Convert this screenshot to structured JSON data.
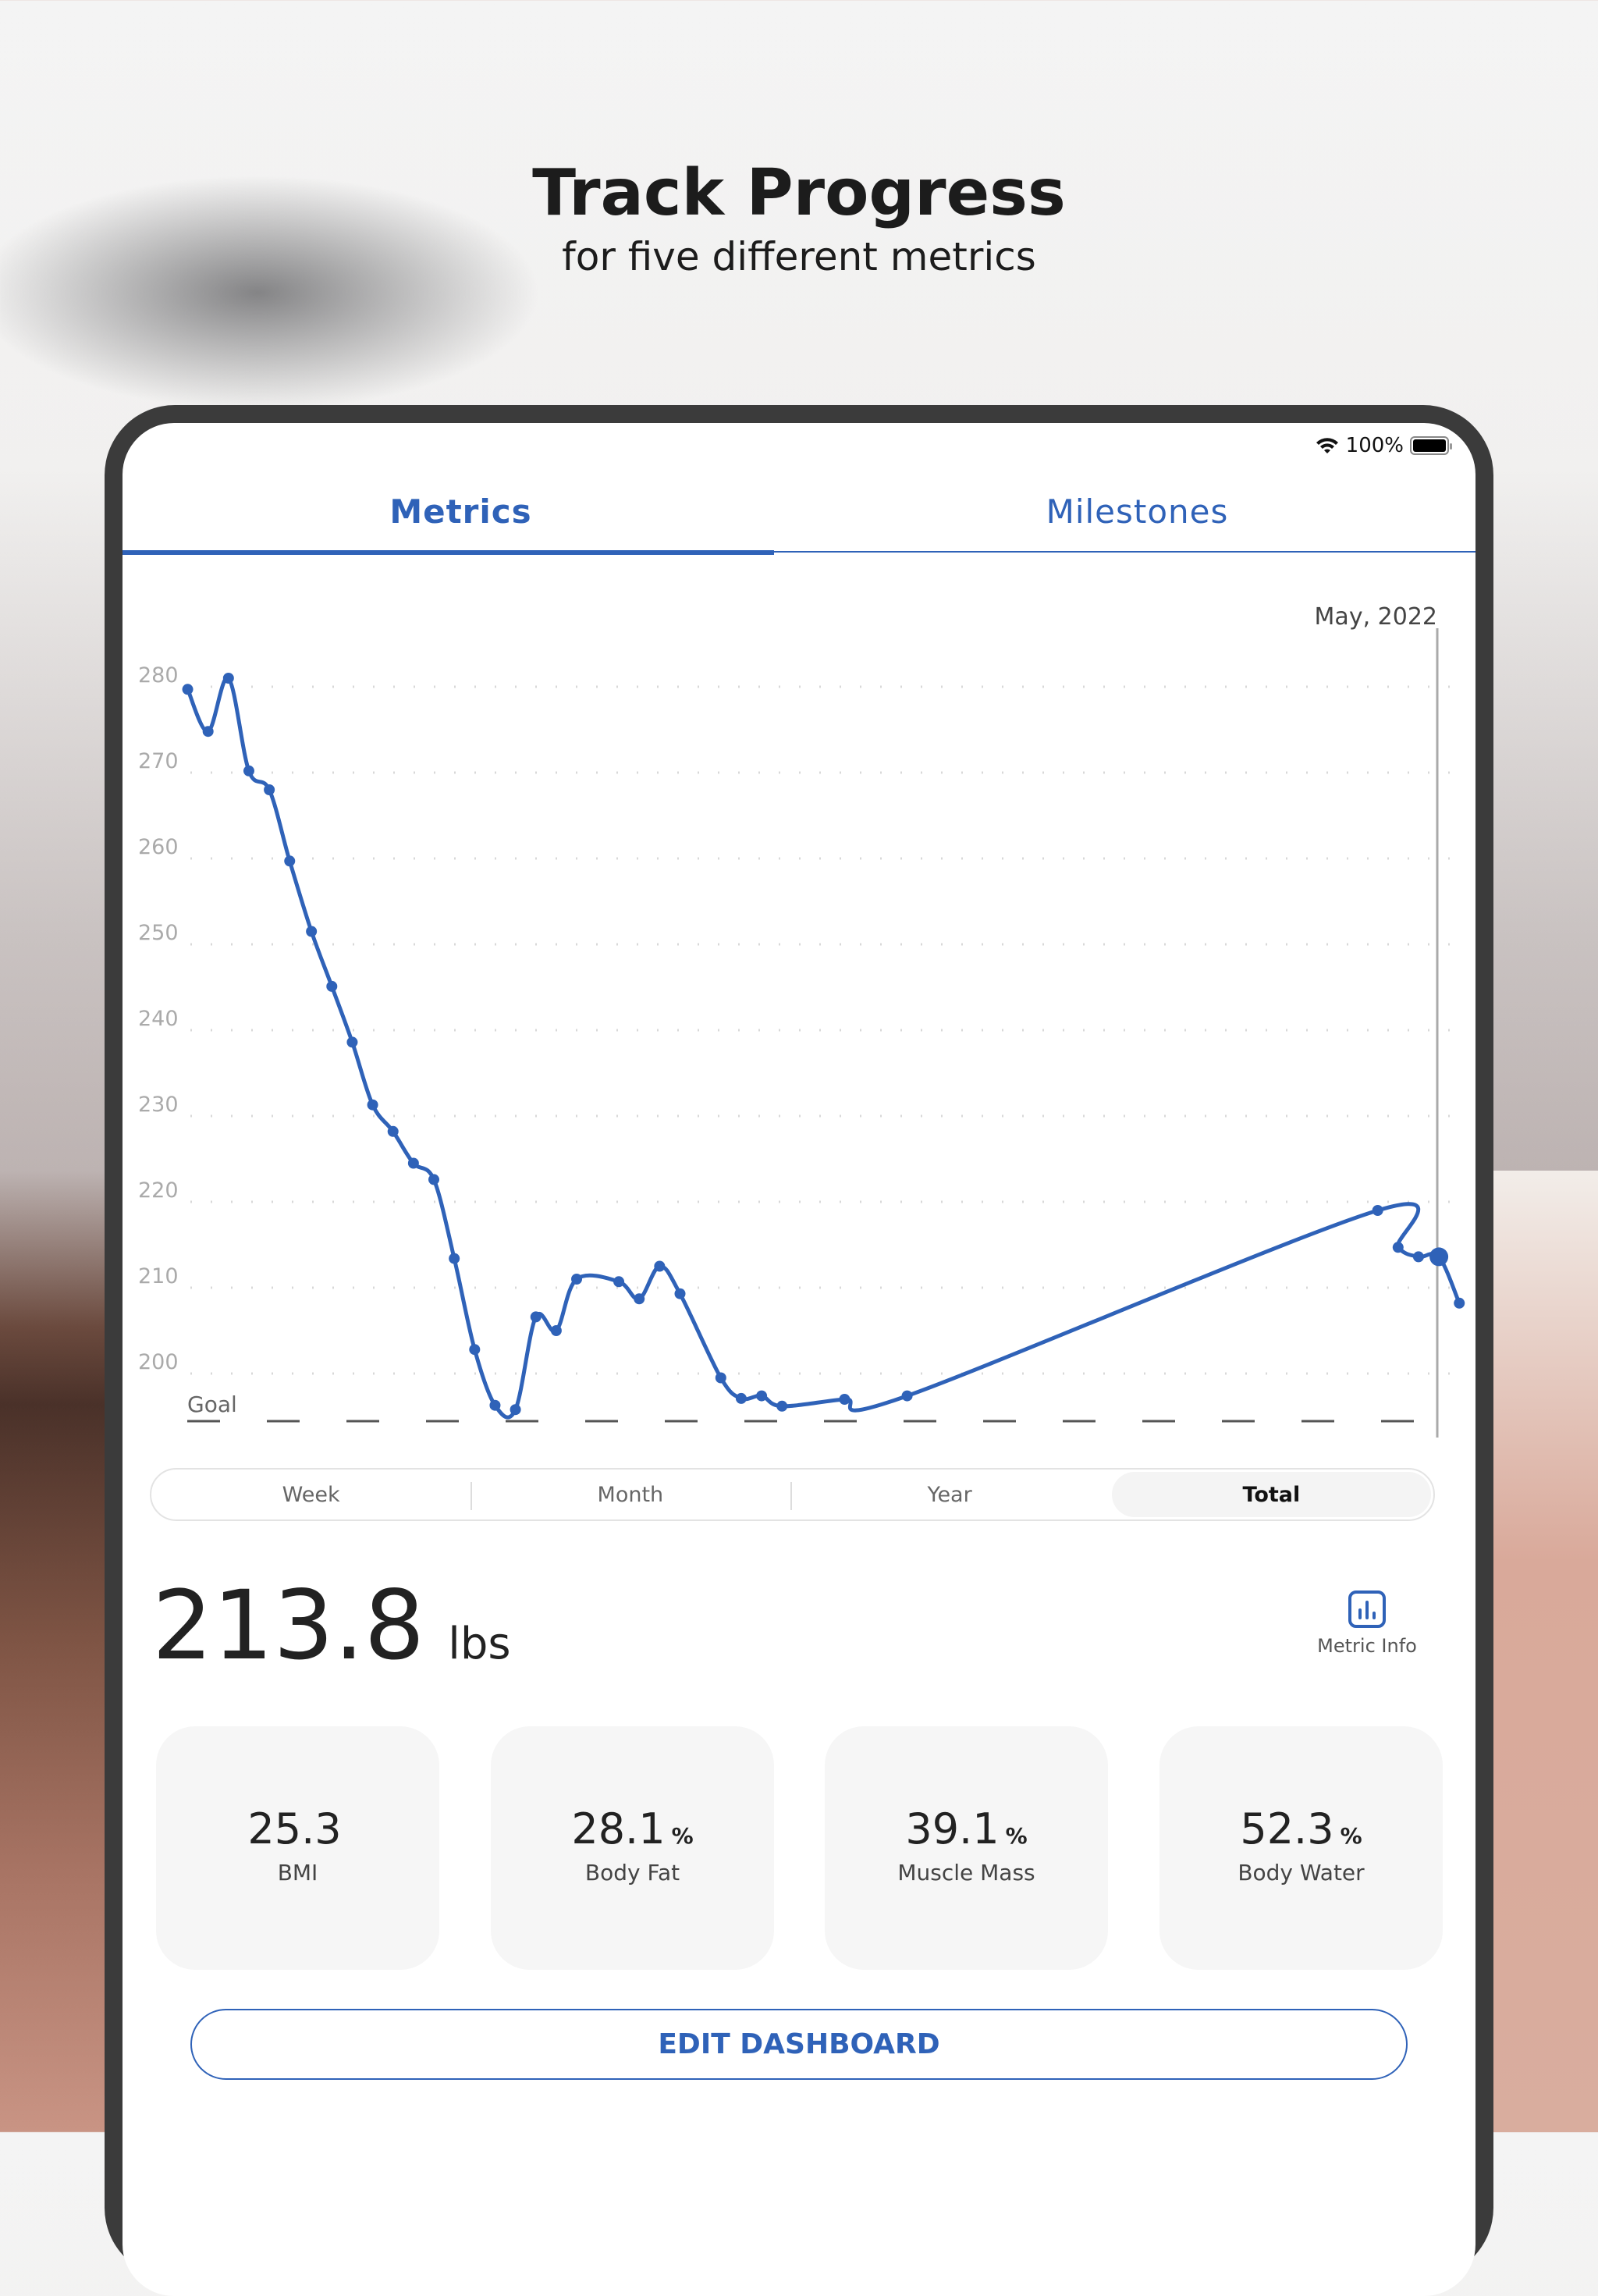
{
  "headline": {
    "title": "Track Progress",
    "subtitle": "for five different metrics"
  },
  "status": {
    "battery": "100%",
    "icons": [
      "wifi-icon",
      "battery-icon"
    ]
  },
  "tabs": [
    {
      "label": "Metrics",
      "active": true
    },
    {
      "label": "Milestones",
      "active": false
    }
  ],
  "accent": "#2f62b8",
  "chart_data": {
    "type": "line",
    "title": "",
    "xlabel": "",
    "ylabel": "",
    "ylim": [
      195,
      282
    ],
    "yticks": [
      280,
      270,
      260,
      250,
      240,
      230,
      220,
      210,
      200
    ],
    "goal": {
      "label": "Goal",
      "value": 195
    },
    "selected": {
      "label": "May, 2022",
      "value": 213.6
    },
    "grid": true,
    "series": [
      {
        "color": "#2f62b8",
        "values": [
          279.7,
          274.8,
          281,
          270.2,
          268,
          259.7,
          251.5,
          245.1,
          238.6,
          231.3,
          228.2,
          224.5,
          222.6,
          213.4,
          202.8,
          196.3,
          195.8,
          206.6,
          205,
          211,
          210.7,
          208.7,
          212.5,
          209.3,
          199.5,
          197.1,
          197.4,
          196.2,
          197,
          197.4,
          219,
          214.7,
          213.6,
          213.6,
          208.2
        ]
      }
    ]
  },
  "ranges": [
    {
      "label": "Week"
    },
    {
      "label": "Month"
    },
    {
      "label": "Year"
    },
    {
      "label": "Total",
      "selected": true
    }
  ],
  "current": {
    "value": "213.8",
    "unit": "lbs"
  },
  "metric_info": {
    "label": "Metric Info",
    "icon": "bar-chart-icon"
  },
  "cards": [
    {
      "value": "25.3",
      "unit": "",
      "label": "BMI"
    },
    {
      "value": "28.1",
      "unit": "%",
      "label": "Body Fat"
    },
    {
      "value": "39.1",
      "unit": "%",
      "label": "Muscle Mass"
    },
    {
      "value": "52.3",
      "unit": "%",
      "label": "Body Water"
    }
  ],
  "edit_button": "EDIT DASHBOARD"
}
